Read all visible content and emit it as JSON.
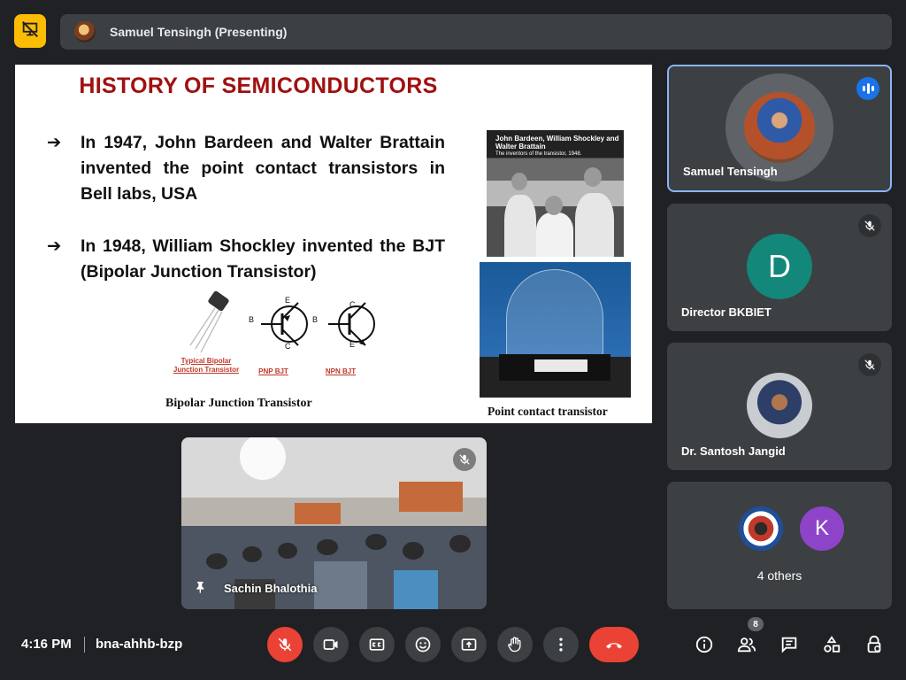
{
  "header": {
    "presenter_label": "Samuel Tensingh (Presenting)"
  },
  "slide": {
    "title": "HISTORY OF SEMICONDUCTORS",
    "bullet_marker": "➔",
    "bullets": [
      "In 1947, John Bardeen and Walter Brattain invented the point contact transistors in Bell labs, USA",
      "In 1948, William Shockley invented the BJT (Bipolar Junction Transistor)"
    ],
    "photo_caption_line1": "John Bardeen, William Shockley and Walter Brattain",
    "photo_caption_line2": "The inventors of the transistor, 1948.",
    "typical_bjt_label": "Typical Bipolar Junction Transistor",
    "pnp_label": "PNP BJT",
    "npn_label": "NPN BJT",
    "pin_b": "B",
    "pin_c": "C",
    "pin_e": "E",
    "bjt_caption": "Bipolar Junction Transistor",
    "pct_caption": "Point contact transistor"
  },
  "camera_feed": {
    "name": "Sachin Bhalothia"
  },
  "participants": [
    {
      "name": "Samuel Tensingh",
      "state": "speaking"
    },
    {
      "name": "Director BKBIET",
      "initial": "D",
      "color": "#12877a",
      "state": "muted"
    },
    {
      "name": "Dr. Santosh Jangid",
      "state": "muted"
    },
    {
      "name": "4 others",
      "initial": "K",
      "color": "#8e44c8"
    }
  ],
  "footer": {
    "time": "4:16 PM",
    "meeting_code": "bna-ahhb-bzp",
    "participant_count": "8"
  },
  "colors": {
    "background": "#202124",
    "tile": "#3c4043",
    "accent_blue": "#8ab4f8",
    "red": "#ea4335",
    "presenting_yellow": "#fbbc04",
    "slide_title": "#a01010"
  },
  "icons": [
    "presentation-off-icon",
    "mic-off-icon",
    "videocam-icon",
    "captions-icon",
    "emoji-icon",
    "present-screen-icon",
    "raise-hand-icon",
    "more-options-icon",
    "call-end-icon",
    "info-icon",
    "people-icon",
    "chat-icon",
    "activities-icon",
    "host-controls-icon",
    "pin-icon",
    "speaking-icon"
  ]
}
